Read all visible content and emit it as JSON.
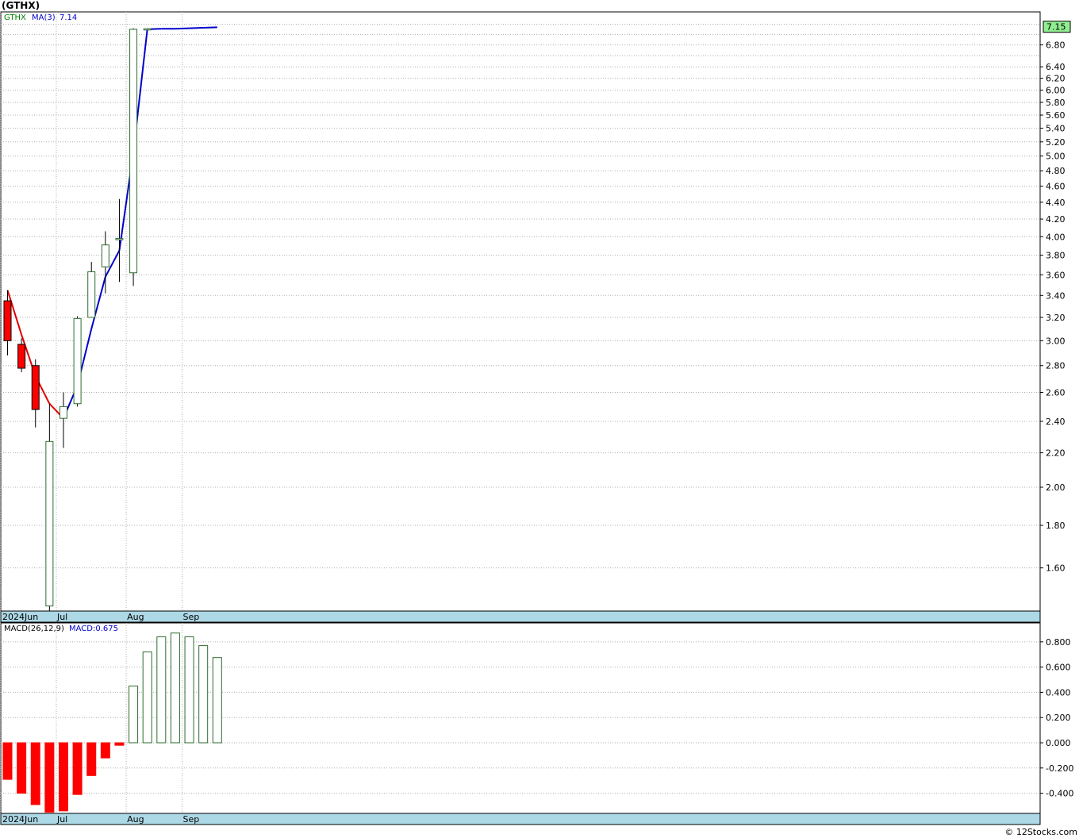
{
  "chart_title": "(GTHX)",
  "credit": "© 12Stocks.com",
  "colors": {
    "up_candle_border": "#2e6b2e",
    "down_candle_fill": "#ff0000",
    "ma_falling": "#e00000",
    "ma_rising": "#0000cc",
    "grid": "#b0b0b0",
    "axis_band": "#add8e6",
    "last_price_box": "#90ee90",
    "legend_ticker": "#008000",
    "legend_ma": "#0000cc"
  },
  "chart_data": [
    {
      "type": "candlestick",
      "legend": {
        "ticker": "GTHX",
        "ma_label": "MA(3)",
        "ma_value": "7.14"
      },
      "last_price_label": "7.15",
      "x_tick_labels": [
        "2024Jun",
        "Jul",
        "Aug",
        "Sep"
      ],
      "x_tick_positions": [
        0,
        4,
        9,
        13
      ],
      "y_axis": {
        "scale": "log",
        "range": [
          1.42,
          7.45
        ],
        "tick_labels": [
          "1.60",
          "1.80",
          "2.00",
          "2.20",
          "2.40",
          "2.60",
          "2.80",
          "3.00",
          "3.20",
          "3.40",
          "3.60",
          "3.80",
          "4.00",
          "4.20",
          "4.40",
          "4.60",
          "4.80",
          "5.00",
          "5.20",
          "5.40",
          "5.60",
          "5.80",
          "6.00",
          "6.20",
          "6.40",
          "6.80"
        ],
        "grid_values": [
          1.6,
          1.8,
          2.0,
          2.2,
          2.4,
          2.6,
          2.8,
          3.0,
          3.2,
          3.4,
          3.6,
          3.8,
          4.0,
          4.2,
          4.4,
          4.6,
          4.8,
          5.0,
          5.2,
          5.4,
          5.6,
          5.8,
          6.0,
          6.2,
          6.4,
          6.6,
          6.8,
          7.0,
          7.2
        ]
      },
      "grid": true,
      "candles": [
        {
          "open": 3.35,
          "high": 3.45,
          "low": 2.88,
          "close": 3.0
        },
        {
          "open": 2.97,
          "high": 3.02,
          "low": 2.75,
          "close": 2.78
        },
        {
          "open": 2.8,
          "high": 2.85,
          "low": 2.36,
          "close": 2.48
        },
        {
          "open": 1.44,
          "high": 2.52,
          "low": 1.42,
          "close": 2.27
        },
        {
          "open": 2.42,
          "high": 2.6,
          "low": 2.23,
          "close": 2.5
        },
        {
          "open": 2.52,
          "high": 3.21,
          "low": 2.5,
          "close": 3.19
        },
        {
          "open": 3.2,
          "high": 3.73,
          "low": 3.2,
          "close": 3.63
        },
        {
          "open": 3.68,
          "high": 4.06,
          "low": 3.42,
          "close": 3.91
        },
        {
          "open": 3.97,
          "high": 4.44,
          "low": 3.53,
          "close": 3.98
        },
        {
          "open": 3.62,
          "high": 7.12,
          "low": 3.49,
          "close": 7.1
        },
        {
          "open": 7.1,
          "high": 7.12,
          "low": 7.08,
          "close": 7.11
        },
        {
          "open": 7.1,
          "high": 7.13,
          "low": 7.08,
          "close": 7.11
        },
        {
          "open": 7.11,
          "high": 7.15,
          "low": 7.1,
          "close": 7.12
        },
        {
          "open": 7.12,
          "high": 7.14,
          "low": 7.11,
          "close": 7.13
        },
        {
          "open": 7.13,
          "high": 7.15,
          "low": 7.12,
          "close": 7.14
        },
        {
          "open": 7.14,
          "high": 7.16,
          "low": 7.13,
          "close": 7.15
        }
      ],
      "ma": [
        3.45,
        3.05,
        2.72,
        2.52,
        2.42,
        2.65,
        3.1,
        3.58,
        3.85,
        5.05,
        7.1,
        7.11,
        7.11,
        7.12,
        7.13,
        7.14
      ]
    },
    {
      "type": "bar",
      "legend": {
        "label": "MACD(26,12,9)",
        "value_label": "MACD:0.675"
      },
      "x_tick_labels": [
        "2024Jun",
        "Jul",
        "Aug",
        "Sep"
      ],
      "x_tick_positions": [
        0,
        4,
        9,
        13
      ],
      "y_axis": {
        "range": [
          -0.56,
          0.95
        ],
        "tick_labels": [
          "-0.400",
          "-0.200",
          "0.000",
          "0.200",
          "0.400",
          "0.600",
          "0.800"
        ],
        "tick_values": [
          -0.4,
          -0.2,
          0.0,
          0.2,
          0.4,
          0.6,
          0.8
        ]
      },
      "grid": true,
      "values": [
        -0.29,
        -0.4,
        -0.49,
        -0.55,
        -0.54,
        -0.41,
        -0.26,
        -0.12,
        -0.02,
        0.45,
        0.72,
        0.84,
        0.87,
        0.84,
        0.77,
        0.675
      ]
    }
  ]
}
